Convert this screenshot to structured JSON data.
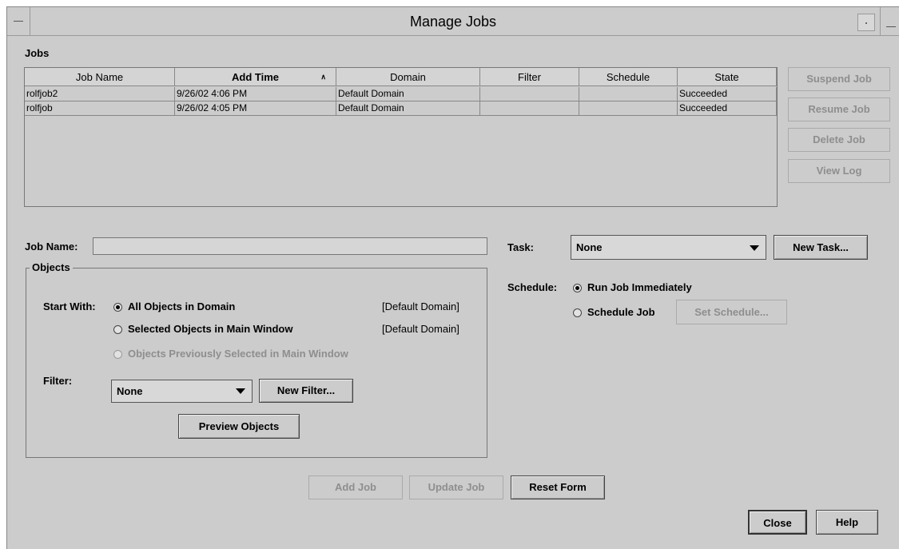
{
  "window": {
    "title": "Manage Jobs"
  },
  "jobs": {
    "section_label": "Jobs",
    "columns": [
      "Job Name",
      "Add Time",
      "Domain",
      "Filter",
      "Schedule",
      "State"
    ],
    "sort_indicator": "∧",
    "rows": [
      [
        "rolfjob2",
        "9/26/02 4:06 PM",
        "Default Domain",
        "",
        "",
        "Succeeded"
      ],
      [
        "rolfjob",
        "9/26/02 4:05 PM",
        "Default Domain",
        "",
        "",
        "Succeeded"
      ]
    ]
  },
  "side_buttons": {
    "suspend": "Suspend Job",
    "resume": "Resume Job",
    "delete": "Delete Job",
    "view_log": "View Log"
  },
  "form": {
    "job_name_label": "Job Name:",
    "job_name_value": "",
    "objects_title": "Objects",
    "start_with_label": "Start With:",
    "options": [
      {
        "label": "All Objects in Domain",
        "selected": true,
        "scope": "[Default Domain]"
      },
      {
        "label": "Selected Objects in Main Window",
        "selected": false,
        "scope": "[Default Domain]"
      },
      {
        "label": "Objects Previously Selected in Main Window",
        "selected": false,
        "scope": ""
      }
    ],
    "filter_label": "Filter:",
    "filter_value": "None",
    "new_filter": "New Filter...",
    "preview_objects": "Preview Objects",
    "task_label": "Task:",
    "task_value": "None",
    "new_task": "New Task...",
    "schedule_label": "Schedule:",
    "run_immediately": "Run Job Immediately",
    "schedule_job": "Schedule Job",
    "set_schedule": "Set Schedule..."
  },
  "bottom_buttons": {
    "add_job": "Add Job",
    "update_job": "Update Job",
    "reset_form": "Reset Form",
    "close": "Close",
    "help": "Help"
  }
}
